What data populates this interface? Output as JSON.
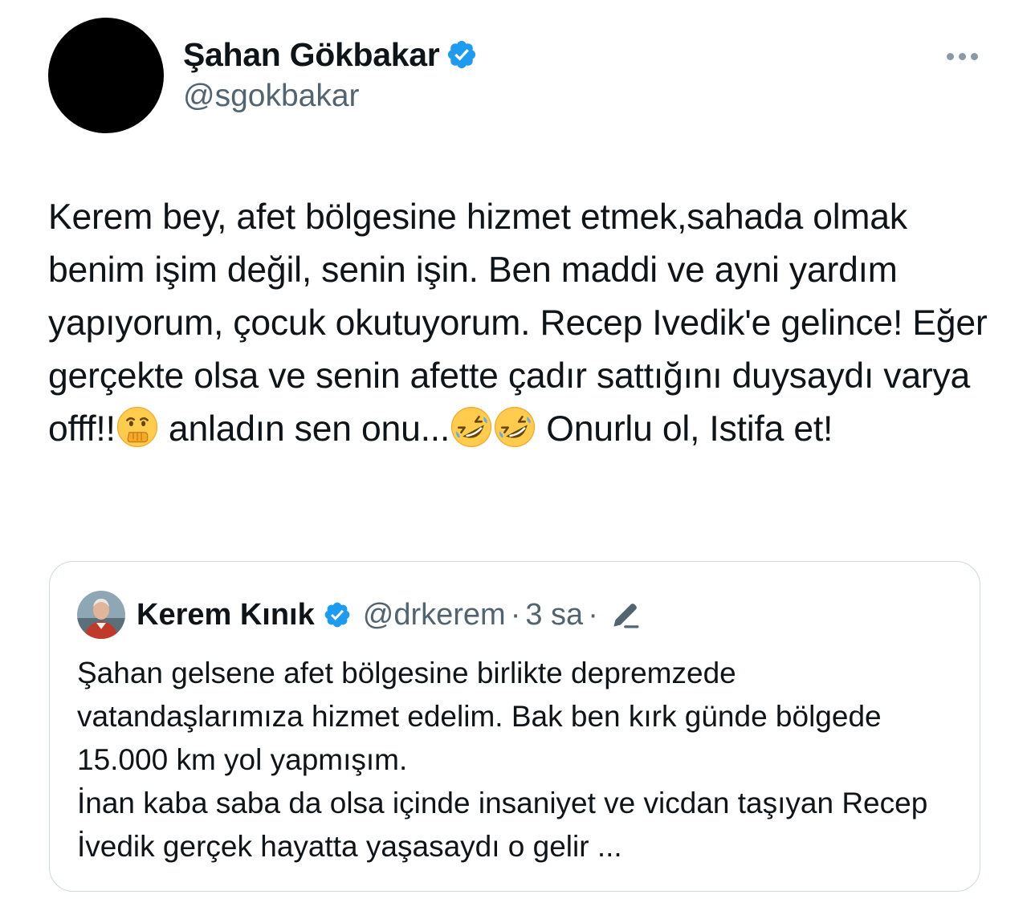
{
  "tweet": {
    "author": {
      "name": "Şahan Gökbakar",
      "handle": "@sgokbakar",
      "verified_icon": "verified-badge-icon",
      "avatar": "redacted-black-circle"
    },
    "more_icon": "more-horizontal-icon",
    "text_parts": {
      "p1": "Kerem bey, afet bölgesine hizmet etmek,sahada olmak benim işim değil, senin işin. Ben maddi ve ayni yardım yapıyorum, çocuk okutuyorum. Recep Ivedik'e gelince! Eğer gerçekte olsa ve senin afette çadır sattığını duysaydı varya offf!!",
      "p2": " anladın sen onu...",
      "p3": " Onurlu ol, Istifa et!"
    },
    "emojis": [
      "face-with-hand-over-mouth-emoji",
      "rolling-on-the-floor-laughing-emoji",
      "rolling-on-the-floor-laughing-emoji"
    ]
  },
  "quote": {
    "author": {
      "name": "Kerem Kınık",
      "handle": "@drkerem",
      "verified_icon": "verified-badge-icon",
      "avatar": "profile-photo"
    },
    "separator": "·",
    "time": "3 sa",
    "edited_icon": "pencil-edit-icon",
    "text": "Şahan gelsene afet bölgesine birlikte depremzede vatandaşlarımıza hizmet edelim. Bak ben kırk günde bölgede 15.000 km yol yapmışım.\nİnan kaba saba da olsa içinde insaniyet ve vicdan taşıyan Recep İvedik gerçek hayatta yaşasaydı o gelir ..."
  },
  "colors": {
    "text": "#0f1419",
    "secondary": "#536471",
    "verified": "#1d9bf0",
    "border": "#cfd9de"
  }
}
